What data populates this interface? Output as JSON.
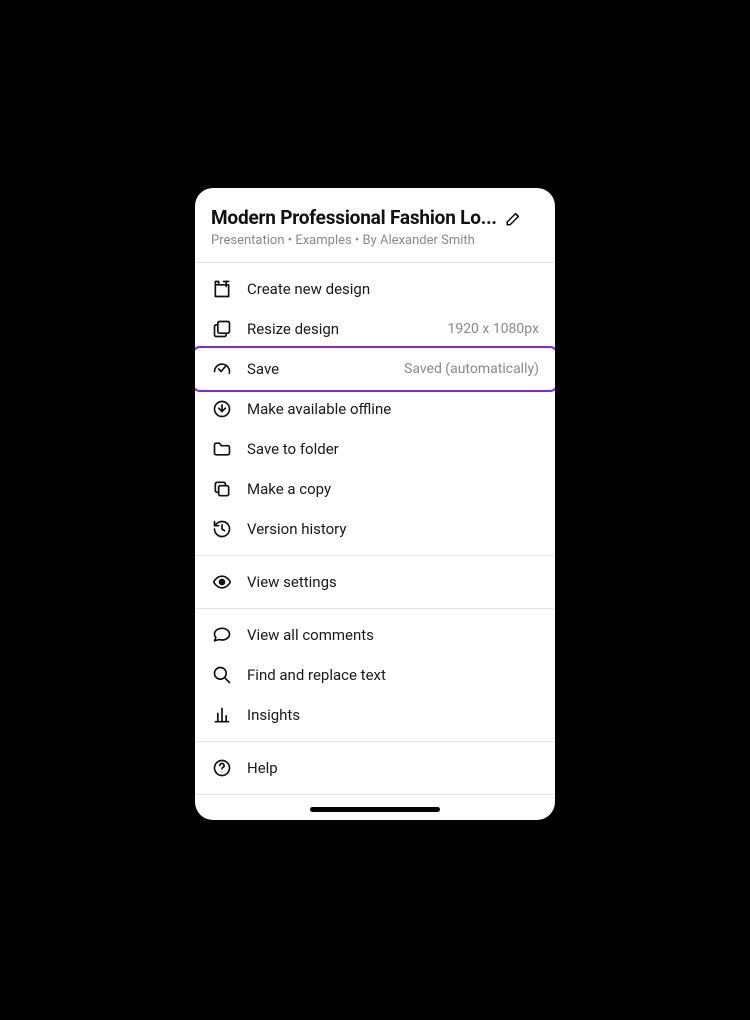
{
  "header": {
    "title": "Modern Professional Fashion Lo...",
    "subtitle": "Presentation • Examples • By Alexander Smith"
  },
  "groups": [
    {
      "items": [
        {
          "icon": "create-icon",
          "label": "Create new design",
          "meta": ""
        },
        {
          "icon": "resize-icon",
          "label": "Resize design",
          "meta": "1920 x 1080px"
        },
        {
          "icon": "save-icon",
          "label": "Save",
          "meta": "Saved (automatically)",
          "highlighted": true
        },
        {
          "icon": "offline-icon",
          "label": "Make available offline",
          "meta": ""
        },
        {
          "icon": "folder-icon",
          "label": "Save to folder",
          "meta": ""
        },
        {
          "icon": "copy-icon",
          "label": "Make a copy",
          "meta": ""
        },
        {
          "icon": "history-icon",
          "label": "Version history",
          "meta": ""
        }
      ]
    },
    {
      "items": [
        {
          "icon": "eye-icon",
          "label": "View settings",
          "meta": ""
        }
      ]
    },
    {
      "items": [
        {
          "icon": "comment-icon",
          "label": "View all comments",
          "meta": ""
        },
        {
          "icon": "search-icon",
          "label": "Find and replace text",
          "meta": ""
        },
        {
          "icon": "insights-icon",
          "label": "Insights",
          "meta": ""
        }
      ]
    },
    {
      "items": [
        {
          "icon": "help-icon",
          "label": "Help",
          "meta": ""
        }
      ]
    }
  ]
}
